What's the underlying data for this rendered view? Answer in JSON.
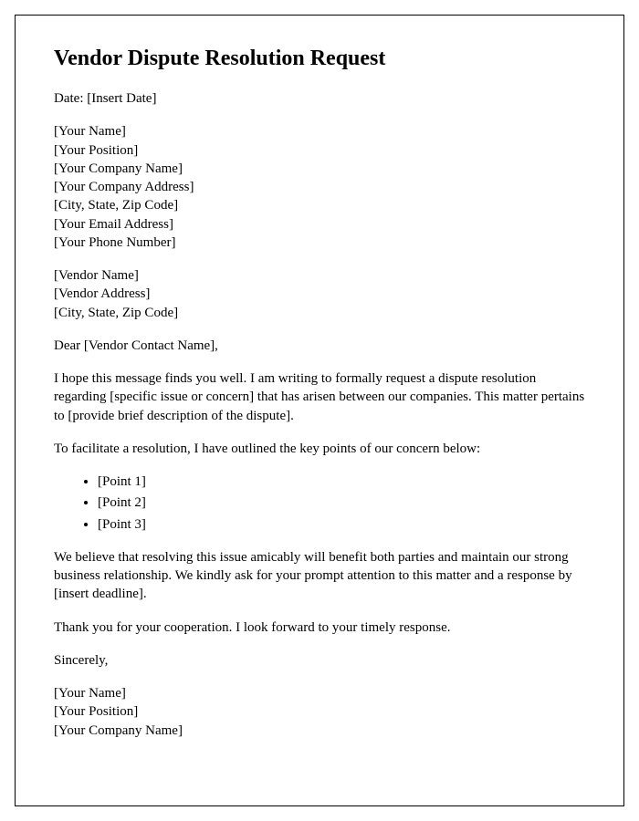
{
  "title": "Vendor Dispute Resolution Request",
  "date": "Date: [Insert Date]",
  "sender": {
    "name": "[Your Name]",
    "position": "[Your Position]",
    "company": "[Your Company Name]",
    "address": "[Your Company Address]",
    "cityStateZip": "[City, State, Zip Code]",
    "email": "[Your Email Address]",
    "phone": "[Your Phone Number]"
  },
  "vendor": {
    "name": "[Vendor Name]",
    "address": "[Vendor Address]",
    "cityStateZip": "[City, State, Zip Code]"
  },
  "salutation": "Dear [Vendor Contact Name],",
  "para1": "I hope this message finds you well. I am writing to formally request a dispute resolution regarding [specific issue or concern] that has arisen between our companies. This matter pertains to [provide brief description of the dispute].",
  "para2": "To facilitate a resolution, I have outlined the key points of our concern below:",
  "points": {
    "p1": "[Point 1]",
    "p2": "[Point 2]",
    "p3": "[Point 3]"
  },
  "para3": "We believe that resolving this issue amicably will benefit both parties and maintain our strong business relationship. We kindly ask for your prompt attention to this matter and a response by [insert deadline].",
  "para4": "Thank you for your cooperation. I look forward to your timely response.",
  "closing": "Sincerely,",
  "signature": {
    "name": "[Your Name]",
    "position": "[Your Position]",
    "company": "[Your Company Name]"
  }
}
